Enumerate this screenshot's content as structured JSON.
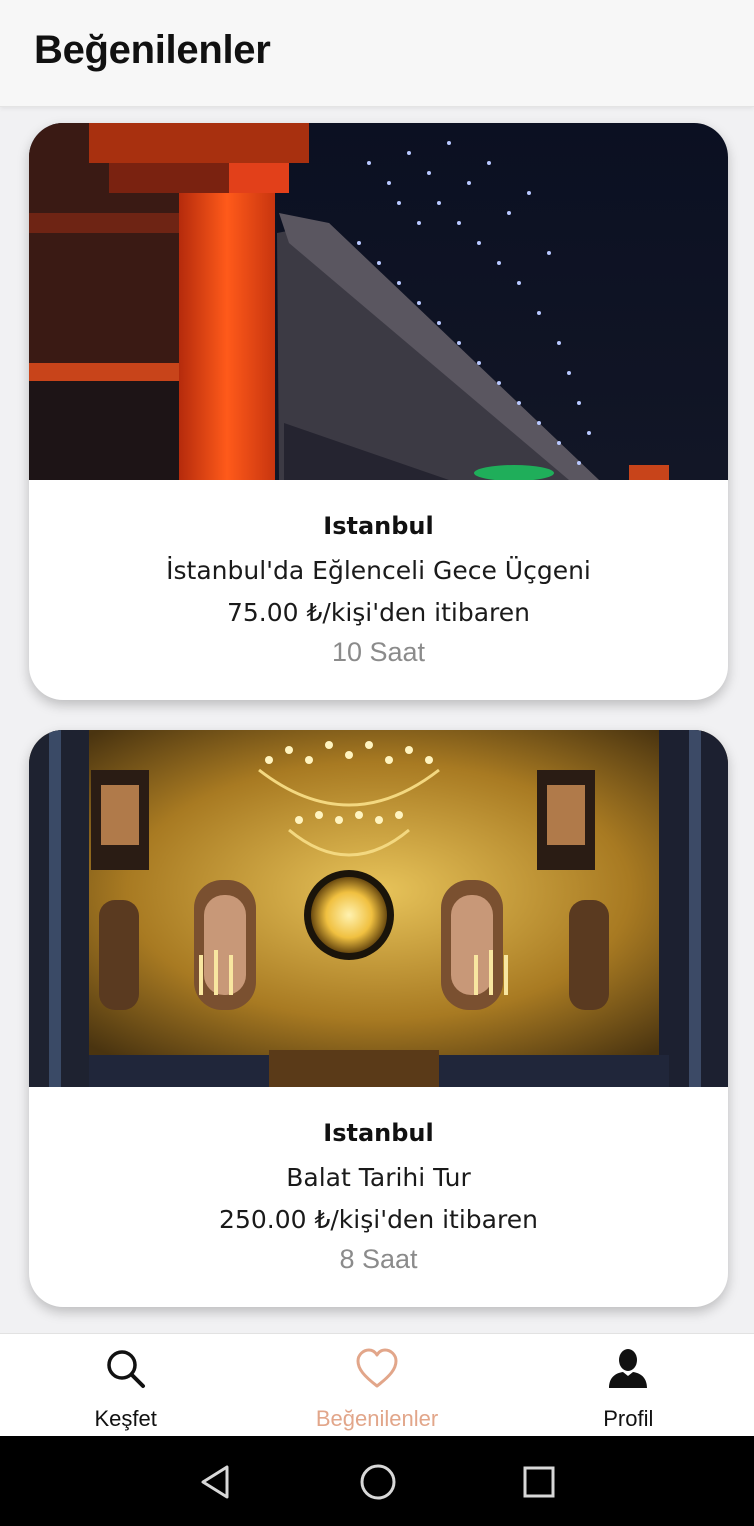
{
  "header": {
    "title": "Beğenilenler"
  },
  "favorites": [
    {
      "city": "Istanbul",
      "title": "İstanbul'da Eğlenceli Gece Üçgeni",
      "price": "75.00 ₺/kişi'den itibaren",
      "duration": "10 Saat",
      "image": "bosphorus-bridge-night-photo"
    },
    {
      "city": "Istanbul",
      "title": "Balat Tarihi Tur",
      "price": "250.00 ₺/kişi'den itibaren",
      "duration": "8 Saat",
      "image": "church-iconostasis-gold-photo"
    }
  ],
  "bottom_nav": {
    "items": [
      {
        "label": "Keşfet",
        "icon": "search-icon",
        "active": false
      },
      {
        "label": "Beğenilenler",
        "icon": "heart-icon",
        "active": true
      },
      {
        "label": "Profil",
        "icon": "person-icon",
        "active": false
      }
    ],
    "active_color": "#e2a68a"
  },
  "system_nav": [
    "back-icon",
    "home-icon",
    "recent-apps-icon"
  ]
}
